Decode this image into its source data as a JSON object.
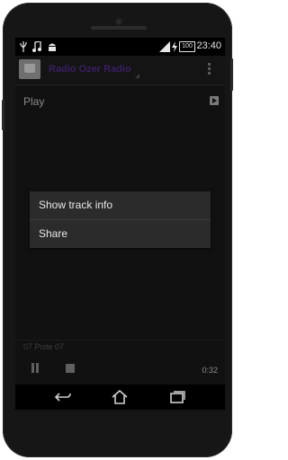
{
  "status_bar": {
    "time": "23:40",
    "battery": "100",
    "icons": [
      "usb-icon",
      "music-note-icon",
      "android-icon",
      "signal-icon",
      "charging-icon"
    ]
  },
  "action_bar": {
    "station_name": "Radio Ozer Radio",
    "overflow_icon": "overflow-menu-icon"
  },
  "player": {
    "play_label": "Play",
    "track": "07 Piste 07",
    "elapsed": "0:32"
  },
  "context_menu": {
    "items": [
      {
        "label": "Show track info"
      },
      {
        "label": "Share"
      }
    ]
  },
  "nav_bar": {
    "icons": [
      "back-icon",
      "home-icon",
      "recent-apps-icon"
    ]
  },
  "colors": {
    "screen_bg": "#111111",
    "dialog_bg": "#2b2b2b",
    "station_text": "#3b1f63"
  }
}
